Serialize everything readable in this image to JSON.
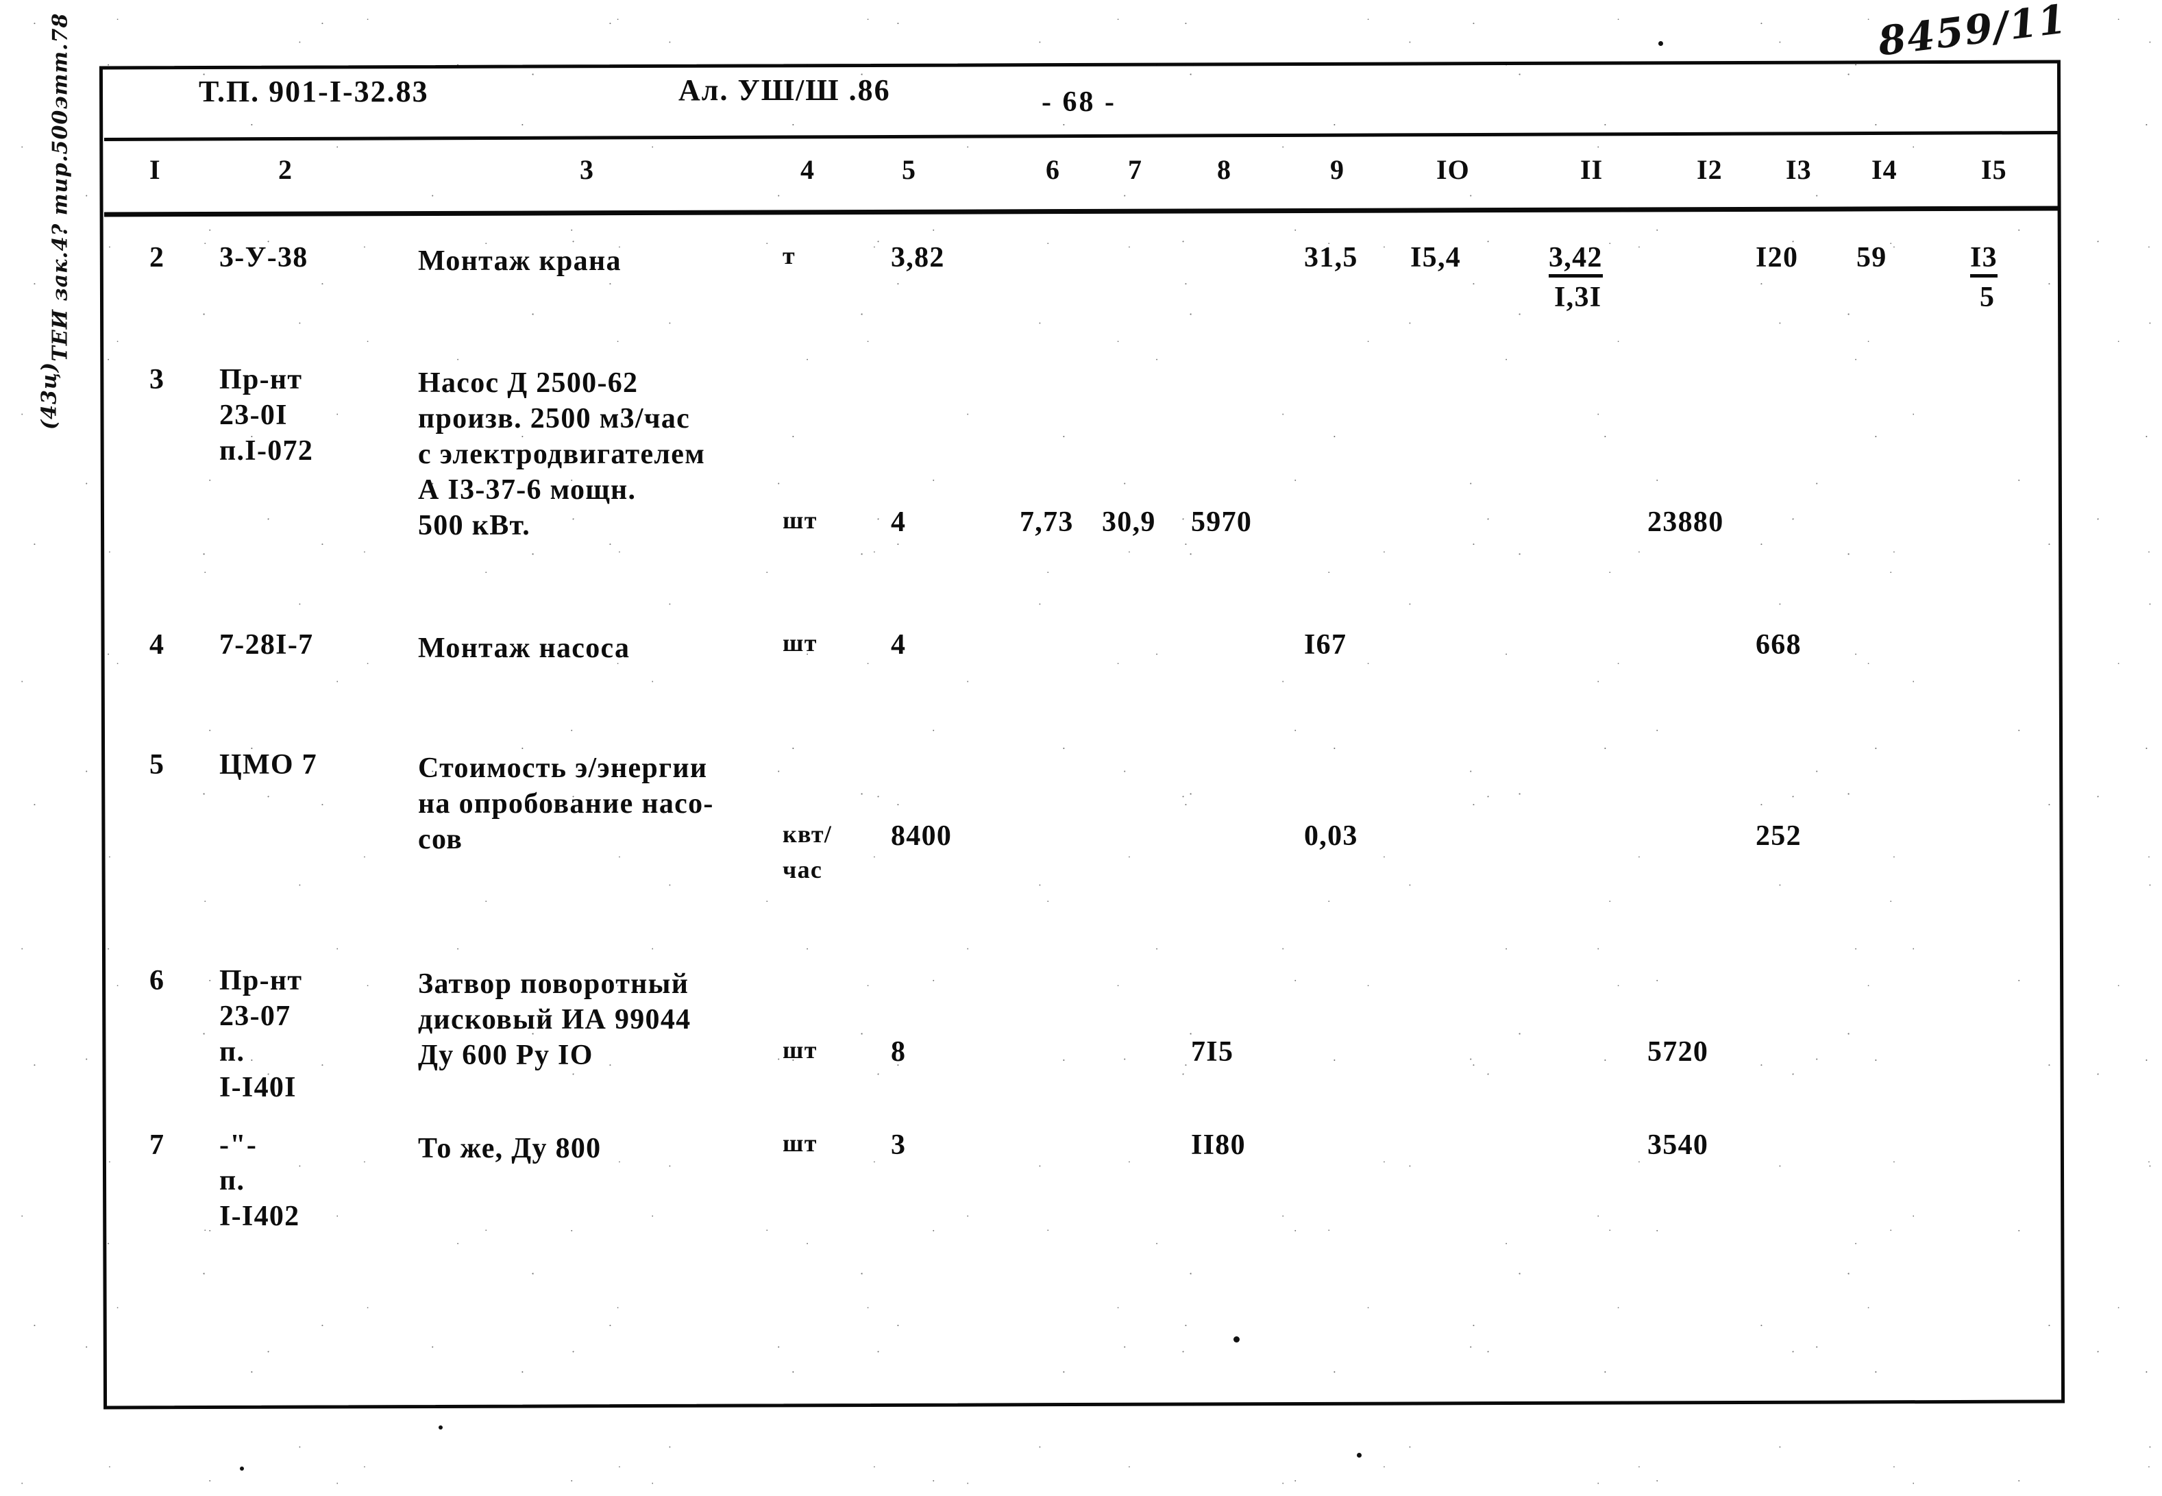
{
  "document": {
    "project_code": "Т.П. 901-I-32.83",
    "album": "Ал. УШ/Ш .86",
    "page_number": "- 68 -",
    "marginalia": {
      "top_right": "8459/11",
      "left_vertical_1": "ТЕИ зак.4? тир.500этт.78",
      "left_vertical_2": "(43ц)"
    }
  },
  "table": {
    "column_headers": [
      "I",
      "2",
      "3",
      "4",
      "5",
      "6",
      "7",
      "8",
      "9",
      "IO",
      "II",
      "I2",
      "I3",
      "I4",
      "I5"
    ],
    "rows": [
      {
        "c1": "2",
        "c2": [
          "3-У-38"
        ],
        "c3": [
          "Монтаж крана"
        ],
        "c4": [
          "т"
        ],
        "c5": "3,82",
        "c6": "",
        "c7": "",
        "c8": "",
        "c9": "31,5",
        "c10": "I5,4",
        "c11_num": "3,42",
        "c11_den": "I,3I",
        "c12": "",
        "c13": "I20",
        "c14": "59",
        "c15_num": "I3",
        "c15_den": "5"
      },
      {
        "c1": "3",
        "c2": [
          "Пр-нт",
          "23-0I",
          "п.I-072"
        ],
        "c3": [
          "Насос Д 2500-62",
          "произв. 2500 м3/час",
          "с электродвигателем",
          "А I3-37-6 мощн.",
          "500 кВт."
        ],
        "c4": [
          "шт"
        ],
        "c5": "4",
        "c6": "7,73",
        "c7": "30,9",
        "c8": "5970",
        "c9": "",
        "c10": "",
        "c11_num": "",
        "c11_den": "",
        "c12": "23880",
        "c13": "",
        "c14": "",
        "c15_num": "",
        "c15_den": ""
      },
      {
        "c1": "4",
        "c2": [
          "7-28I-7"
        ],
        "c3": [
          "Монтаж насоса"
        ],
        "c4": [
          "шт"
        ],
        "c5": "4",
        "c6": "",
        "c7": "",
        "c8": "",
        "c9": "I67",
        "c10": "",
        "c11_num": "",
        "c11_den": "",
        "c12": "",
        "c13": "668",
        "c14": "",
        "c15_num": "",
        "c15_den": ""
      },
      {
        "c1": "5",
        "c2": [
          "ЦМО 7"
        ],
        "c3": [
          "Стоимость э/энергии",
          "на опробование насо-",
          "сов"
        ],
        "c4": [
          "квт/",
          "час"
        ],
        "c5": "8400",
        "c6": "",
        "c7": "",
        "c8": "",
        "c9": "0,03",
        "c10": "",
        "c11_num": "",
        "c11_den": "",
        "c12": "",
        "c13": "252",
        "c14": "",
        "c15_num": "",
        "c15_den": ""
      },
      {
        "c1": "6",
        "c2": [
          "Пр-нт",
          "23-07",
          "п.",
          "I-I40I"
        ],
        "c3": [
          "Затвор поворотный",
          "дисковый ИА 99044",
          "Ду 600 Ру IO"
        ],
        "c4": [
          "шт"
        ],
        "c5": "8",
        "c6": "",
        "c7": "",
        "c8": "7I5",
        "c9": "",
        "c10": "",
        "c11_num": "",
        "c11_den": "",
        "c12": "5720",
        "c13": "",
        "c14": "",
        "c15_num": "",
        "c15_den": ""
      },
      {
        "c1": "7",
        "c2": [
          "-\"-",
          "п.",
          "I-I402"
        ],
        "c3": [
          "То же, Ду 800"
        ],
        "c4": [
          "шт"
        ],
        "c5": "3",
        "c6": "",
        "c7": "",
        "c8": "II80",
        "c9": "",
        "c10": "",
        "c11_num": "",
        "c11_den": "",
        "c12": "3540",
        "c13": "",
        "c14": "",
        "c15_num": "",
        "c15_den": ""
      }
    ]
  }
}
